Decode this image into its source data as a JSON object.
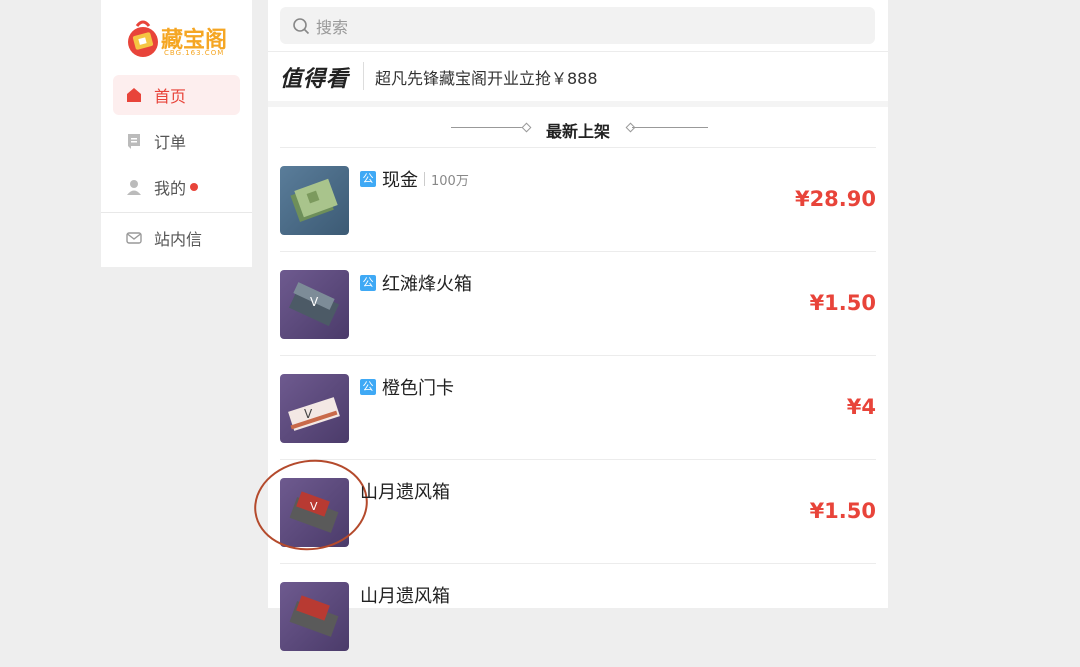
{
  "sidebar": {
    "logo_text": "藏宝阁",
    "logo_sub": "CBG.163.COM",
    "items": [
      {
        "label": "首页",
        "active": true
      },
      {
        "label": "订单",
        "active": false
      },
      {
        "label": "我的",
        "active": false,
        "badge_dot": true
      },
      {
        "label": "站内信",
        "active": false
      }
    ]
  },
  "search": {
    "placeholder": "搜索"
  },
  "promo": {
    "title": "值得看",
    "text": "超凡先锋藏宝阁开业立抢￥888"
  },
  "section": {
    "title": "最新上架"
  },
  "listings": [
    {
      "name": "现金",
      "official_badge": "公",
      "qty": "100万",
      "price": "¥28.90",
      "thumb": "cash-icon"
    },
    {
      "name": "红滩烽火箱",
      "official_badge": "公",
      "price": "¥1.50",
      "thumb": "crate-icon"
    },
    {
      "name": "橙色门卡",
      "official_badge": "公",
      "price": "¥4",
      "thumb": "keycard-icon"
    },
    {
      "name": "山月遗风箱",
      "price": "¥1.50",
      "thumb": "red-crate-icon"
    },
    {
      "name": "山月遗风箱"
    }
  ],
  "colors": {
    "accent": "#e8443a",
    "official": "#3fa9f5",
    "logo": "#f5a623"
  }
}
